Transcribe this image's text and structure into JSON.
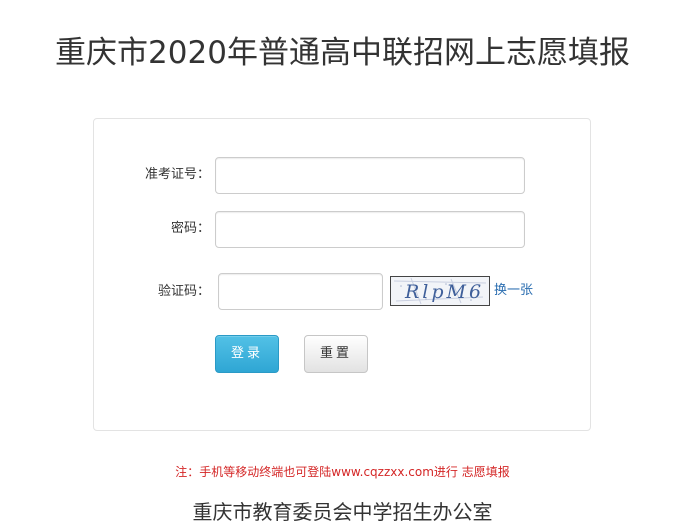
{
  "page": {
    "title": "重庆市2020年普通高中联招网上志愿填报"
  },
  "form": {
    "exam_id_label": "准考证号：",
    "exam_id_value": "",
    "password_label": "密码：",
    "password_value": "",
    "captcha_label": "验证码：",
    "captcha_value": "",
    "captcha_text": "RlpM6",
    "refresh_captcha": "换一张",
    "login_button": "登录",
    "reset_button": "重置"
  },
  "note": "注：手机等移动终端也可登陆www.cqzzxx.com进行 志愿填报",
  "footer": "重庆市教育委员会中学招生办公室",
  "colors": {
    "primary_button": "#3bb0dc",
    "note_text": "#d42626",
    "link": "#2a6db0"
  }
}
